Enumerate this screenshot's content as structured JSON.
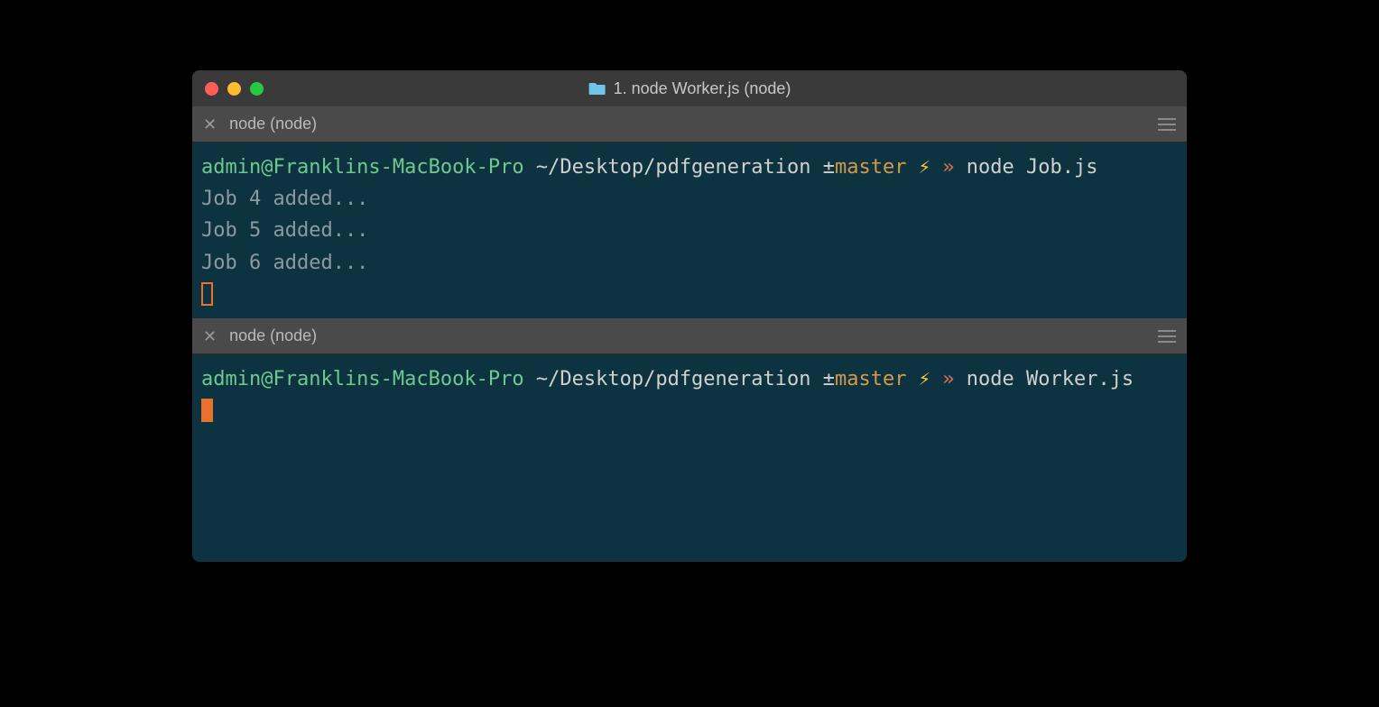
{
  "window": {
    "title": "1. node Worker.js (node)"
  },
  "panes": [
    {
      "tab_label": "node (node)",
      "prompt": {
        "user_host": "admin@Franklins-MacBook-Pro",
        "path": "~/Desktop/pdfgeneration",
        "branch_symbol": "±",
        "branch": "master",
        "bolt": "⚡",
        "arrow": "»",
        "command": "node Job.js"
      },
      "output": [
        "Job 4 added...",
        "Job 5 added...",
        "Job 6 added..."
      ],
      "cursor_style": "outline"
    },
    {
      "tab_label": "node (node)",
      "prompt": {
        "user_host": "admin@Franklins-MacBook-Pro",
        "path": "~/Desktop/pdfgeneration",
        "branch_symbol": "±",
        "branch": "master",
        "bolt": "⚡",
        "arrow": "»",
        "command": "node Worker.js"
      },
      "output": [],
      "cursor_style": "block"
    }
  ]
}
